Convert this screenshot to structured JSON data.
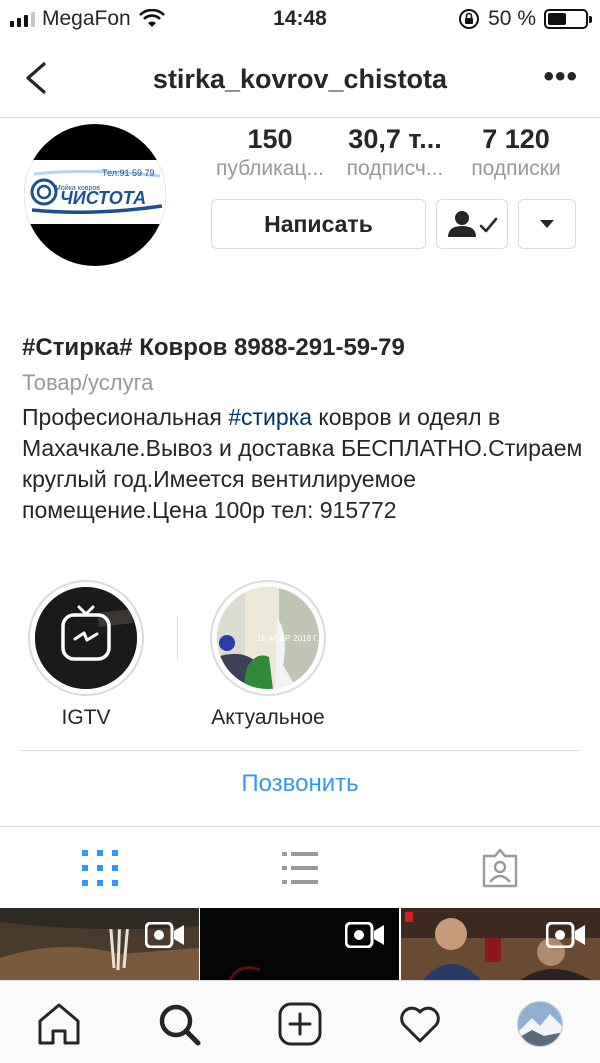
{
  "status_bar": {
    "carrier": "MegaFon",
    "time": "14:48",
    "battery_percent": "50 %",
    "battery_level": 0.5
  },
  "navbar": {
    "title": "stirka_kovrov_chistota",
    "more_label": "•••"
  },
  "avatar": {
    "logo_small_text": "Мойка ковров",
    "logo_phone": "Тел:91 59 79",
    "logo_brand": "ЧИСТОТА"
  },
  "stats": [
    {
      "value": "150",
      "label": "публикац..."
    },
    {
      "value": "30,7 т...",
      "label": "подписч..."
    },
    {
      "value": "7 120",
      "label": "подписки"
    }
  ],
  "buttons": {
    "message_label": "Написать"
  },
  "bio": {
    "name": "#Стирка# Ковров 8988-291-59-79",
    "category": "Товар/услуга",
    "text_before": "Професиональная ",
    "hashtag": "#стирка",
    "text_after": " ковров и одеял в Махачкале.Вывоз и доставка БЕСПЛАТНО.Стираем круглый год.Имеется вентилируемое помещение.Цена 100р тел: 915772"
  },
  "highlights": [
    {
      "label": "IGTV",
      "icon": "igtv-icon"
    },
    {
      "label": "Актуальное",
      "icon": "story-thumbnail"
    }
  ],
  "highlight_overlay_text": "16 ФЕВР. 2018 Г.",
  "contact": {
    "call_label": "Позвонить"
  },
  "tabs": [
    {
      "name": "grid",
      "icon": "grid-icon",
      "active": true
    },
    {
      "name": "list",
      "icon": "list-icon",
      "active": false
    },
    {
      "name": "tagged",
      "icon": "tagged-icon",
      "active": false
    }
  ],
  "grid_posts": [
    {
      "type": "video",
      "icon": "video-icon"
    },
    {
      "type": "video",
      "icon": "video-icon"
    },
    {
      "type": "video",
      "icon": "video-icon"
    }
  ],
  "bottom_nav": [
    {
      "name": "home",
      "icon": "home-icon"
    },
    {
      "name": "search",
      "icon": "search-icon",
      "active": true
    },
    {
      "name": "new-post",
      "icon": "add-icon"
    },
    {
      "name": "activity",
      "icon": "heart-icon"
    },
    {
      "name": "profile",
      "icon": "profile-avatar"
    }
  ],
  "colors": {
    "accent_blue": "#3897f0",
    "hashtag_link": "#003569",
    "grid_active": "#3897f0",
    "secondary_text": "#999999",
    "border": "#dbdbdb"
  }
}
